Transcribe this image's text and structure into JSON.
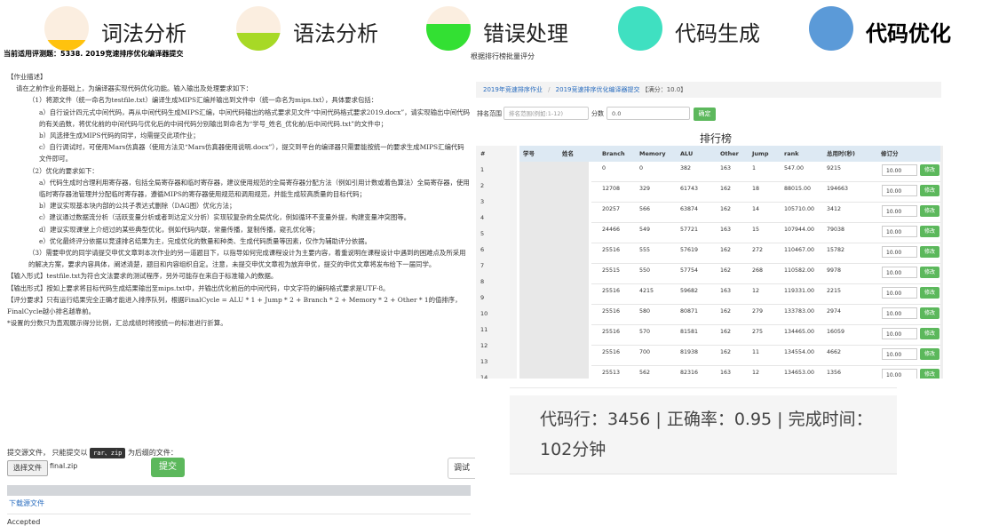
{
  "colors": {
    "accent_green": "#5cb85c",
    "link_blue": "#2a6dbf",
    "table_header": "#dde9f3",
    "stage_bg": "#fbeee0"
  },
  "stages": [
    {
      "label": "词法分析",
      "fill_fraction": 0.25,
      "fill_color": "#ffc20e",
      "current": false
    },
    {
      "label": "语法分析",
      "fill_fraction": 0.4,
      "fill_color": "#a7d926",
      "current": false
    },
    {
      "label": "错误处理",
      "fill_fraction": 0.6,
      "fill_color": "#33e033",
      "current": false
    },
    {
      "label": "代码生成",
      "fill_fraction": 1.0,
      "fill_color": "#3fe0c1",
      "current": false
    },
    {
      "label": "代码优化",
      "fill_fraction": 1.0,
      "fill_color": "#5b9ad8",
      "current": true
    }
  ],
  "doc": {
    "title": "当前适用评测题：5338. 2019竞速排序优化编译器提交",
    "lines": [
      {
        "text": "【作业描述】",
        "indent": 0
      },
      {
        "text": "请在之前作业的基础上，为编译器实现代码优化功能。输入输出及处理要求如下：",
        "indent": 1
      },
      {
        "text": "（1）将源文件（统一命名为testfile.txt）编译生成MIPS汇编并输出到文件中（统一命名为mips.txt），具体要求包括：",
        "indent": 2
      },
      {
        "text": "a）自行设计四元式中间代码，再从中间代码生成MIPS汇编，中间代码输出的格式要求见文件“中间代码格式要求2019.docx”，请实现输出中间代码的有关函数，将优化前的中间代码与优化后的中间代码分别输出到命名为“学号_姓名_优化前/后中间代码.txt”的文件中；",
        "indent": 3
      },
      {
        "text": "b）风选择生成MIPS代码的同学，均需提交此项作业；",
        "indent": 3
      },
      {
        "text": "c）自行调试时，可使用Mars仿真器（使用方法见“Mars仿真器使用说明.docx”），提交到平台的编译器只需要能按统一的要求生成MIPS汇编代码文件即可。",
        "indent": 3
      },
      {
        "text": "（2）优化的要求如下：",
        "indent": 2
      },
      {
        "text": "a）代码生成时合理利用寄存器，包括全局寄存器和临时寄存器，建议使用规范的全局寄存器分配方法（例如引用计数或着色算法）全局寄存器，使用临时寄存器池管理并分配临时寄存器，遵循MIPS的寄存器使用规范和调用规范，并能生成较高质量的目标代码；",
        "indent": 3
      },
      {
        "text": "b）建议实现基本块内部的公共子表达式删除（DAG图）优化方法；",
        "indent": 3
      },
      {
        "text": "c）建议通过数据流分析（活跃变量分析或者到达定义分析）实现较复杂的全局优化，例如循环不变量外提，构建变量冲突图等。",
        "indent": 3
      },
      {
        "text": "d）建议实现课堂上介绍过的某些典型优化，例如代码内联，常量传播，复制传播，窥孔优化等；",
        "indent": 3
      },
      {
        "text": "e）优化最终评分依据以竞速排名结果为主，完成优化的数量和种类、生成代码质量等因素，仅作为辅助评分依据。",
        "indent": 3
      },
      {
        "text": "（3）需要申优的同学请提交申优文章到本次作业的另一道题目下，以指导如何完成课程设计为主要内容，着重说明在课程设计中遇到的困难点及所采用的解决方案，要求内容具体，阐述清楚，题目和内容组织自定。注意，未提交申优文章视为放弃申优，提交的申优文章将发布给下一届同学。",
        "indent": 2
      },
      {
        "text": "【输入形式】testfile.txt为符合文法要求的测试程序，另外可能存在来自于标准输入的数据。",
        "indent": 0
      },
      {
        "text": "【输出形式】按如上要求将目标代码生成结果输出至mips.txt中，并输出优化前后的中间代码，中文字符的编码格式要求是UTF-8。",
        "indent": 0
      },
      {
        "text": "【评分要求】只有运行结果完全正确才能进入排序队列，根据FinalCycle = ALU * 1 + Jump * 2 + Branch * 2 + Memory * 2 + Other * 1的值排序，FinalCycle越小排名越靠前。",
        "indent": 0
      },
      {
        "text": "*设置的分数只为直观展示得分比例，汇总成绩时将按统一的标准进行折算。",
        "indent": 0
      }
    ]
  },
  "submit": {
    "hint_prefix": "提交源文件，  只能提交以",
    "hint_chip": "rar、zip",
    "hint_suffix": "为后缀的文件：",
    "choose_label": "选择文件",
    "file_name": "final.zip",
    "submit_label": "提交",
    "debug_label": "调试",
    "download_label": "下载源文件",
    "status": "Accepted"
  },
  "ranking": {
    "panel_title": "根据排行榜批量评分",
    "breadcrumb": [
      "2019年竞速排序作业",
      "2019竞速排序优化编译器提交"
    ],
    "crumb_score": "【满分：10.0】",
    "rank_range_label": "排名范围",
    "rank_range_placeholder": "排名范围(例如:1-12)",
    "score_label": "分数",
    "score_value": "0.0",
    "confirm_label": "确定",
    "board_title": "排行榜",
    "columns": [
      "#",
      "学号",
      "姓名",
      "Branch",
      "Memory",
      "ALU",
      "Other",
      "Jump",
      "rank",
      "总用时(秒)",
      "修订分"
    ],
    "edit_label": "修改",
    "rows": [
      {
        "idx": "1",
        "branch": "0",
        "memory": "0",
        "alu": "382",
        "other": "163",
        "jump": "1",
        "rank": "547.00",
        "time": "9215",
        "score": "10.00"
      },
      {
        "idx": "2",
        "branch": "12708",
        "memory": "329",
        "alu": "61743",
        "other": "162",
        "jump": "18",
        "rank": "88015.00",
        "time": "194663",
        "score": "10.00"
      },
      {
        "idx": "3",
        "branch": "20257",
        "memory": "566",
        "alu": "63874",
        "other": "162",
        "jump": "14",
        "rank": "105710.00",
        "time": "3412",
        "score": "10.00"
      },
      {
        "idx": "4",
        "branch": "24466",
        "memory": "549",
        "alu": "57721",
        "other": "163",
        "jump": "15",
        "rank": "107944.00",
        "time": "79038",
        "score": "10.00"
      },
      {
        "idx": "5",
        "branch": "25516",
        "memory": "555",
        "alu": "57619",
        "other": "162",
        "jump": "272",
        "rank": "110467.00",
        "time": "15782",
        "score": "10.00"
      },
      {
        "idx": "6",
        "branch": "25515",
        "memory": "550",
        "alu": "57754",
        "other": "162",
        "jump": "268",
        "rank": "110582.00",
        "time": "9978",
        "score": "10.00"
      },
      {
        "idx": "7",
        "branch": "25516",
        "memory": "4215",
        "alu": "59682",
        "other": "163",
        "jump": "12",
        "rank": "119331.00",
        "time": "2215",
        "score": "10.00"
      },
      {
        "idx": "8",
        "branch": "25516",
        "memory": "580",
        "alu": "80871",
        "other": "162",
        "jump": "279",
        "rank": "133783.00",
        "time": "2974",
        "score": "10.00"
      },
      {
        "idx": "9",
        "branch": "25516",
        "memory": "570",
        "alu": "81581",
        "other": "162",
        "jump": "275",
        "rank": "134465.00",
        "time": "16059",
        "score": "10.00"
      },
      {
        "idx": "10",
        "branch": "25516",
        "memory": "700",
        "alu": "81938",
        "other": "162",
        "jump": "11",
        "rank": "134554.00",
        "time": "4662",
        "score": "10.00"
      },
      {
        "idx": "11",
        "branch": "25513",
        "memory": "562",
        "alu": "82316",
        "other": "163",
        "jump": "12",
        "rank": "134653.00",
        "time": "1356",
        "score": "10.00"
      }
    ],
    "extra_idx": [
      "12",
      "13",
      "14"
    ]
  },
  "stats": {
    "line1": "代码行：3456 | 正确率：0.95 | 完成时间：",
    "line2": "102分钟"
  }
}
